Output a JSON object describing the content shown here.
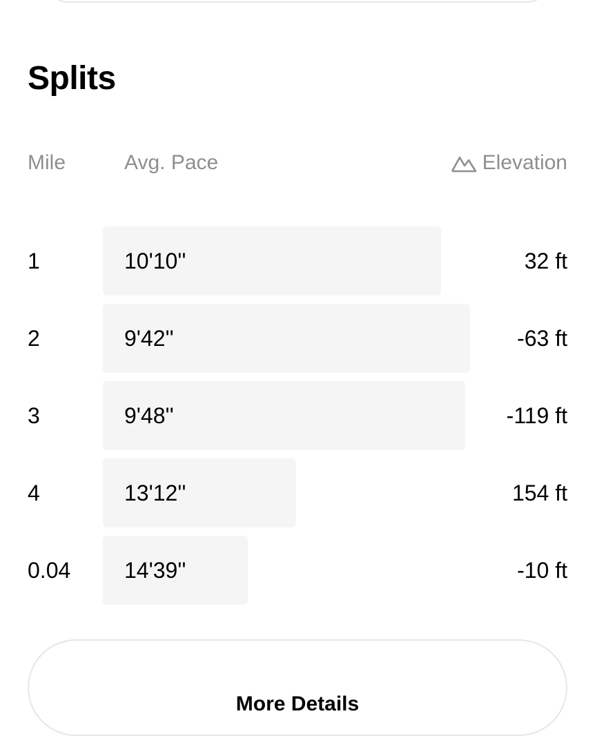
{
  "splits": {
    "title": "Splits",
    "headers": {
      "mile": "Mile",
      "pace": "Avg. Pace",
      "elevation": "Elevation",
      "elevation_icon": "mountain-icon"
    },
    "bar_color": "#f5f5f5",
    "rows": [
      {
        "mile": "1",
        "pace": "10'10''",
        "elevation": "32 ft",
        "pace_bar_fraction": 0.7
      },
      {
        "mile": "2",
        "pace": "9'42''",
        "elevation": "-63 ft",
        "pace_bar_fraction": 0.76
      },
      {
        "mile": "3",
        "pace": "9'48''",
        "elevation": "-119 ft",
        "pace_bar_fraction": 0.75
      },
      {
        "mile": "4",
        "pace": "13'12''",
        "elevation": "154 ft",
        "pace_bar_fraction": 0.4
      },
      {
        "mile": "0.04",
        "pace": "14'39''",
        "elevation": "-10 ft",
        "pace_bar_fraction": 0.3
      }
    ]
  },
  "actions": {
    "more_details_label": "More Details"
  }
}
